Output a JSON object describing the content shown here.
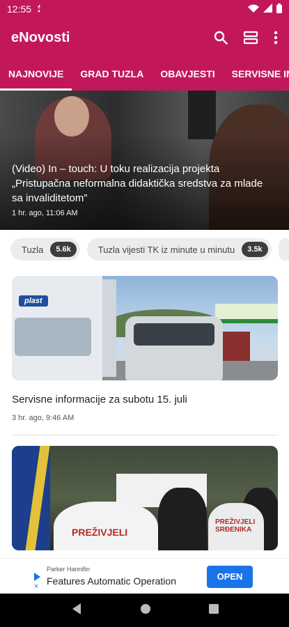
{
  "status_bar": {
    "time": "12:55"
  },
  "app_bar": {
    "title": "eNovosti"
  },
  "tabs": [
    {
      "label": "NAJNOVIJE",
      "active": true
    },
    {
      "label": "GRAD TUZLA",
      "active": false
    },
    {
      "label": "OBAVJESTI",
      "active": false
    },
    {
      "label": "SERVISNE INFO",
      "active": false
    }
  ],
  "hero": {
    "headline": "(Video) In – touch: U toku realizacija projekta „Pristupačna neformalna didaktička sredstva za mlade sa invaliditetom”",
    "meta": "1 hr. ago, 11:06 AM"
  },
  "chips": [
    {
      "label": "Tuzla",
      "count": "5.6k"
    },
    {
      "label": "Tuzla vijesti TK iz minute u minutu",
      "count": "3.5k"
    }
  ],
  "articles": [
    {
      "title": "Servisne informacije za subotu 15. juli",
      "meta": "3 hr. ago, 9:46 AM",
      "image_text": "plast"
    },
    {
      "title": "",
      "meta": "",
      "image_text": "PREŽIVJELI",
      "image_text_small": "PREŽIVJELI\nSRĐENIKA"
    }
  ],
  "ad": {
    "advertiser": "Parker Hannifin",
    "headline": "Features Automatic Operation",
    "cta": "OPEN"
  },
  "colors": {
    "brand": "#c2185b",
    "ad_button": "#1a73e8"
  }
}
